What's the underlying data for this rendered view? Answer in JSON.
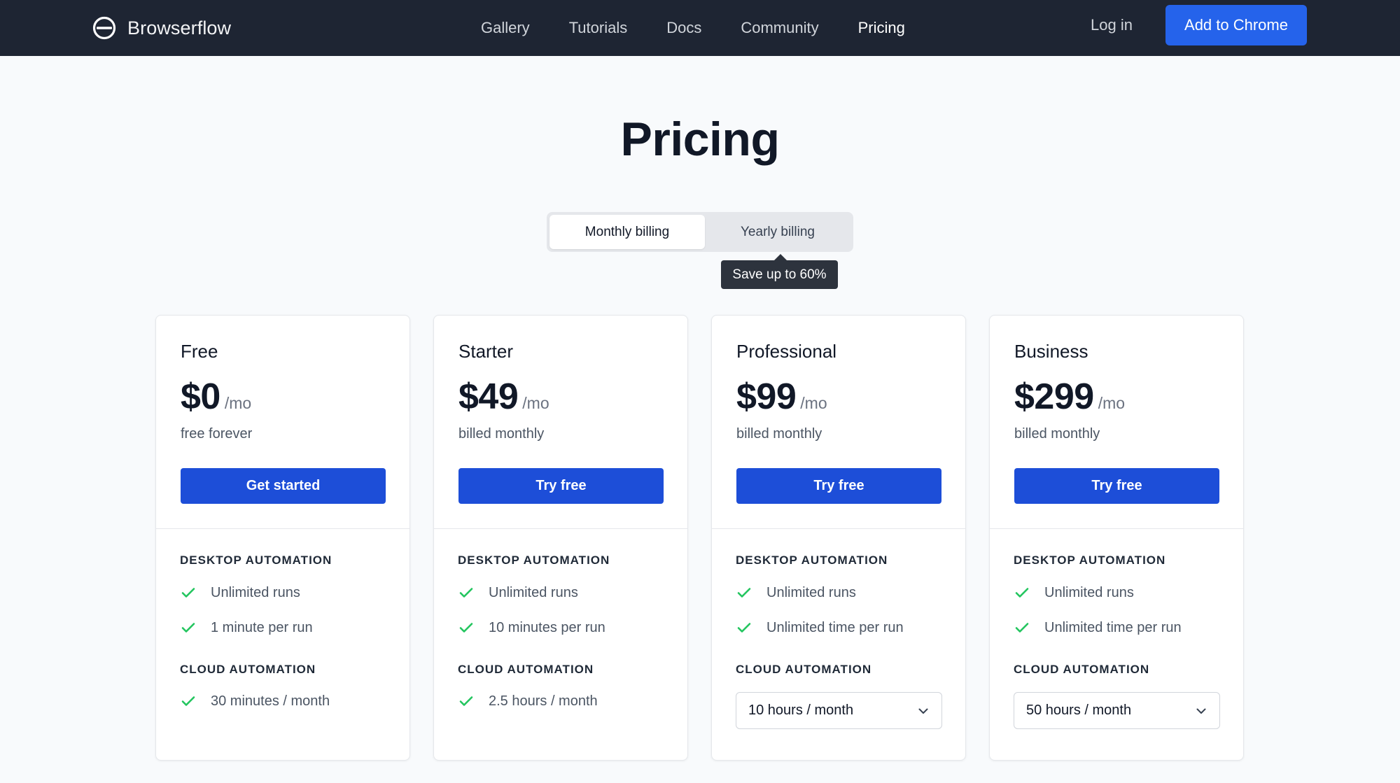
{
  "nav": {
    "brand": "Browserflow",
    "links": [
      {
        "label": "Gallery"
      },
      {
        "label": "Tutorials"
      },
      {
        "label": "Docs"
      },
      {
        "label": "Community"
      },
      {
        "label": "Pricing"
      }
    ],
    "active": "Pricing",
    "login": "Log in",
    "cta": "Add to Chrome"
  },
  "page": {
    "title": "Pricing",
    "billing_toggle": {
      "options": [
        "Monthly billing",
        "Yearly billing"
      ],
      "selected": "Monthly billing",
      "tooltip": "Save up to 60%"
    }
  },
  "plans": [
    {
      "name": "Free",
      "price": "$0",
      "period": "/mo",
      "note": "free forever",
      "cta": "Get started",
      "desktop_title": "DESKTOP AUTOMATION",
      "desktop_features": [
        "Unlimited runs",
        "1 minute per run"
      ],
      "cloud_title": "CLOUD AUTOMATION",
      "cloud": "30 minutes / month"
    },
    {
      "name": "Starter",
      "price": "$49",
      "period": "/mo",
      "note": "billed monthly",
      "cta": "Try free",
      "desktop_title": "DESKTOP AUTOMATION",
      "desktop_features": [
        "Unlimited runs",
        "10 minutes per run"
      ],
      "cloud_title": "CLOUD AUTOMATION",
      "cloud": "2.5 hours / month"
    },
    {
      "name": "Professional",
      "price": "$99",
      "period": "/mo",
      "note": "billed monthly",
      "cta": "Try free",
      "desktop_title": "DESKTOP AUTOMATION",
      "desktop_features": [
        "Unlimited runs",
        "Unlimited time per run"
      ],
      "cloud_title": "CLOUD AUTOMATION",
      "cloud_select": "10 hours / month"
    },
    {
      "name": "Business",
      "price": "$299",
      "period": "/mo",
      "note": "billed monthly",
      "cta": "Try free",
      "desktop_title": "DESKTOP AUTOMATION",
      "desktop_features": [
        "Unlimited runs",
        "Unlimited time per run"
      ],
      "cloud_title": "CLOUD AUTOMATION",
      "cloud_select": "50 hours / month"
    }
  ],
  "colors": {
    "nav_bg": "#1e2533",
    "accent": "#2563eb",
    "button": "#1d4ed8",
    "check": "#22c55e",
    "page_bg": "#f8fafc"
  },
  "icons": {
    "brand": "browserflow-logo-icon",
    "check": "check-icon",
    "dropdown": "chevron-down-icon"
  }
}
